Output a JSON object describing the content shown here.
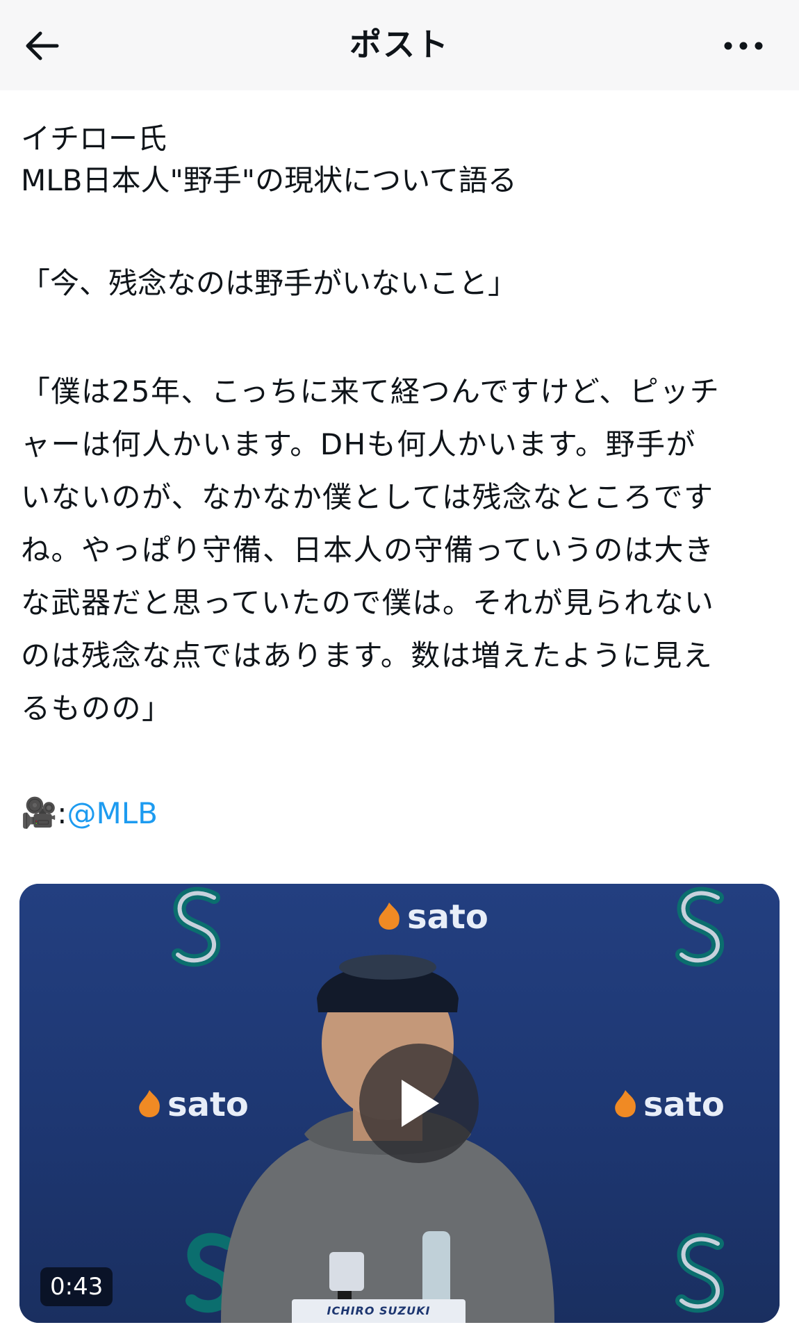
{
  "header": {
    "title": "ポスト",
    "back_icon": "arrow-left-icon",
    "more_icon": "more-horizontal-icon"
  },
  "post": {
    "line1": "イチロー氏",
    "line2": "MLB日本人\"野手\"の現状について語る",
    "quote1": "「今、残念なのは野手がいないこと」",
    "quote2_lines": [
      "「僕は25年、こっちに来て経つんですけど、ピッチ",
      "ャーは何人かいます。DHも何人かいます。野手が",
      "いないのが、なかなか僕としては残念なところです",
      "ね。やっぱり守備、日本人の守備っていうのは大き",
      "な武器だと思っていたので僕は。それが見られない",
      "のは残念な点ではあります。数は増えたように見え",
      "るものの」"
    ],
    "credit_emoji": "🎥",
    "credit_sep": ":",
    "credit_handle": "@MLB"
  },
  "media": {
    "duration": "0:43",
    "sponsor": "sato",
    "nameplate": "ICHIRO SUZUKI",
    "play_icon": "play-icon",
    "colors": {
      "backdrop": "#1f3a78",
      "sponsor_flame": "#f08a24",
      "shirt": "#6a6d70"
    }
  },
  "colors": {
    "link": "#1d9bf0",
    "text": "#0f1419",
    "header_bg": "#f7f7f8"
  }
}
